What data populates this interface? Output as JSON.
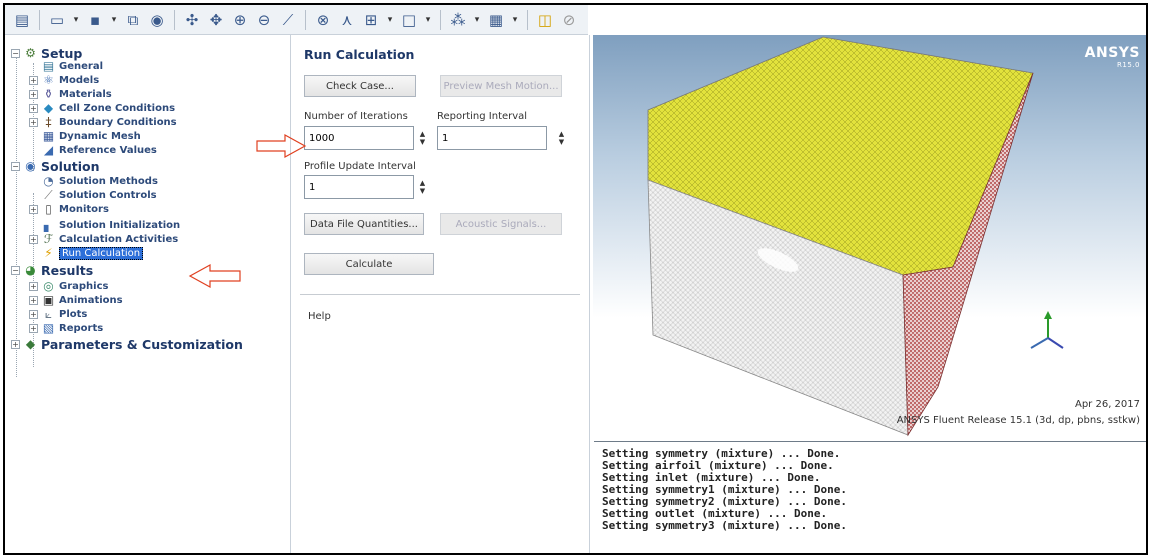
{
  "toolbar": {
    "icons": [
      "print-icon",
      "new-file-icon",
      "save-icon",
      "display-icon",
      "help-icon",
      "rotate-icon",
      "translate-icon",
      "zoom-icon",
      "zoom-out-icon",
      "probe-icon",
      "zoom-fit-icon",
      "select-icon",
      "layout-icon",
      "view-icon",
      "render-icon",
      "color-icon",
      "window-icon",
      "close-icon"
    ]
  },
  "tree": {
    "setup": {
      "label": "Setup",
      "items": [
        "General",
        "Models",
        "Materials",
        "Cell Zone Conditions",
        "Boundary Conditions",
        "Dynamic Mesh",
        "Reference Values"
      ]
    },
    "solution": {
      "label": "Solution",
      "items": [
        "Solution Methods",
        "Solution Controls",
        "Monitors",
        "Solution Initialization",
        "Calculation Activities",
        "Run Calculation"
      ]
    },
    "results": {
      "label": "Results",
      "items": [
        "Graphics",
        "Animations",
        "Plots",
        "Reports"
      ]
    },
    "parameters": {
      "label": "Parameters & Customization"
    }
  },
  "task": {
    "title": "Run Calculation",
    "check_case": "Check Case...",
    "preview_mesh": "Preview Mesh Motion...",
    "iterations_label": "Number of Iterations",
    "iterations_value": "1000",
    "reporting_label": "Reporting Interval",
    "reporting_value": "1",
    "profile_label": "Profile Update Interval",
    "profile_value": "1",
    "data_file": "Data File Quantities...",
    "acoustic": "Acoustic Signals...",
    "calculate": "Calculate",
    "help": "Help"
  },
  "graphics": {
    "logo": "ANSYS",
    "logo_version": "R15.0",
    "date": "Apr 26, 2017",
    "release": "ANSYS Fluent Release 15.1 (3d, dp, pbns, sstkw)",
    "mesh_top_color": "#e0e040",
    "mesh_side_color": "#e8e8e8",
    "mesh_front_color": "#b03030"
  },
  "console": {
    "lines": [
      "Setting symmetry (mixture) ... Done.",
      "Setting airfoil (mixture) ... Done.",
      "Setting inlet (mixture) ... Done.",
      "Setting symmetry1 (mixture) ... Done.",
      "Setting symmetry2 (mixture) ... Done.",
      "Setting outlet (mixture) ... Done.",
      "Setting symmetry3 (mixture) ... Done."
    ]
  },
  "annotation_color": "#e04020"
}
